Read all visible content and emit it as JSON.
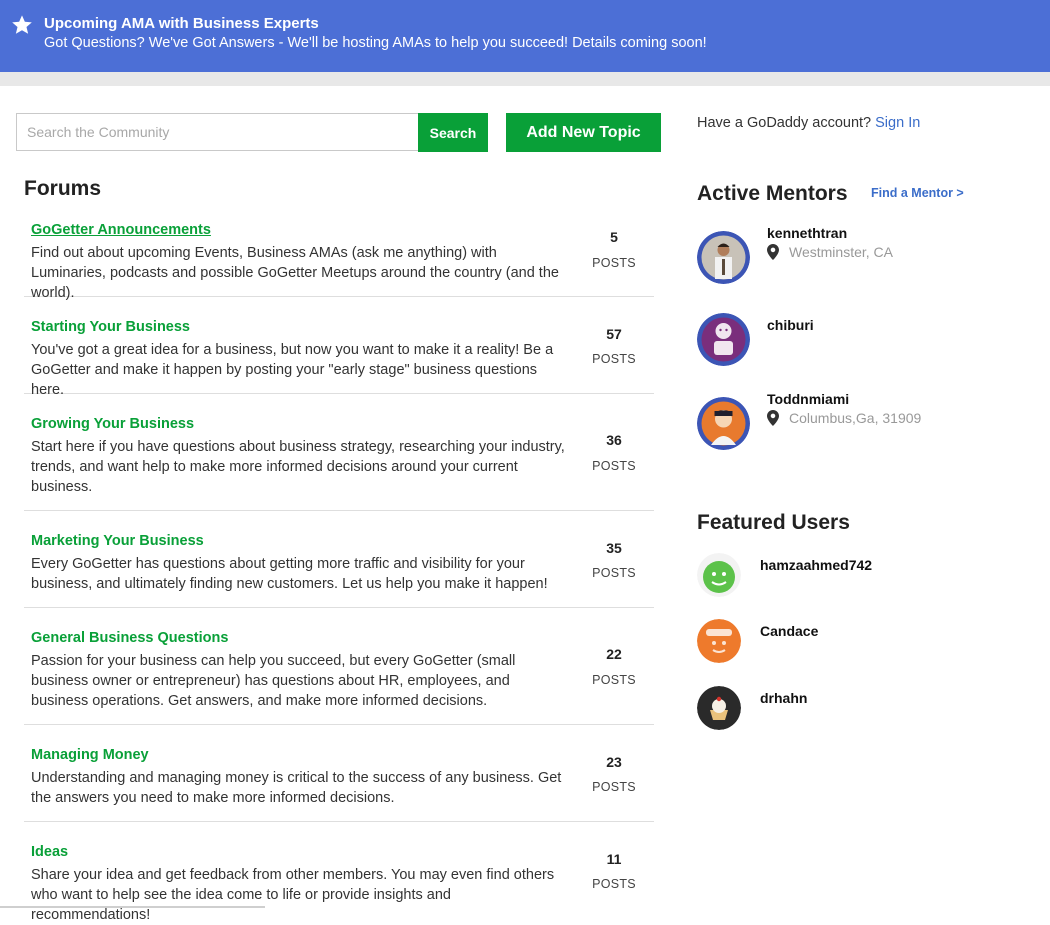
{
  "banner": {
    "icon": "star-icon",
    "title": "Upcoming AMA with Business Experts",
    "text": "Got Questions? We've Got Answers - We'll be hosting AMAs to help you succeed! Details coming soon!",
    "color": "#4c6fd6"
  },
  "search": {
    "placeholder": "Search the Community",
    "button_label": "Search"
  },
  "add_topic_label": "Add New Topic",
  "forums_title": "Forums",
  "forums": [
    {
      "title": "GoGetter Announcements",
      "desc": "Find out about upcoming Events, Business AMAs (ask me anything) with Luminaries, podcasts and possible GoGetter Meetups around the country (and the world).",
      "count": "5",
      "label": "POSTS"
    },
    {
      "title": "Starting Your Business",
      "desc": "You've got a great idea for a business, but now you want to make it a reality! Be a GoGetter and make it happen by posting your \"early stage\" business questions here.",
      "count": "57",
      "label": "POSTS"
    },
    {
      "title": "Growing Your Business",
      "desc": "Start here if you have questions about business strategy, researching your industry, trends, and want help to make more informed decisions around your current business.",
      "count": "36",
      "label": "POSTS"
    },
    {
      "title": "Marketing Your Business",
      "desc": "Every GoGetter has questions about getting more traffic and visibility for your business, and ultimately finding new customers. Let us help you make it happen!",
      "count": "35",
      "label": "POSTS"
    },
    {
      "title": "General Business Questions",
      "desc": "Passion for your business can help you succeed, but every GoGetter (small business owner or entrepreneur) has questions about HR, employees, and business operations. Get answers, and make more informed decisions.",
      "count": "22",
      "label": "POSTS"
    },
    {
      "title": "Managing Money",
      "desc": "Understanding and managing money is critical to the success of any business. Get the answers you need to make more informed decisions.",
      "count": "23",
      "label": "POSTS"
    },
    {
      "title": "Ideas",
      "desc": "Share your idea and get feedback from other members. You may even find others who want to help see the idea come to life or provide insights and recommendations!",
      "count": "11",
      "label": "POSTS"
    }
  ],
  "account": {
    "prompt": "Have a GoDaddy account?",
    "sign_in": "Sign In"
  },
  "active_mentors": {
    "title": "Active Mentors",
    "find_link": "Find a Mentor >",
    "mentors": [
      {
        "name": "kennethtran",
        "location": "Westminster, CA"
      },
      {
        "name": "chiburi",
        "location": ""
      },
      {
        "name": "Toddnmiami",
        "location": "Columbus,Ga, 31909"
      }
    ]
  },
  "featured_users": {
    "title": "Featured Users",
    "users": [
      {
        "name": "hamzaahmed742"
      },
      {
        "name": "Candace"
      },
      {
        "name": "drhahn"
      }
    ]
  },
  "colors": {
    "accent_green": "#09a038",
    "link_blue": "#3b6dc9"
  }
}
